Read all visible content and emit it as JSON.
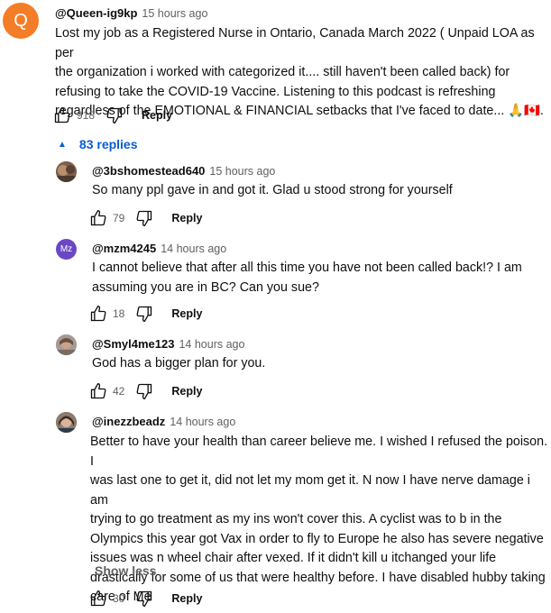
{
  "colors": {
    "link_blue": "#065fd4",
    "muted": "#606060",
    "avatar_main": "#f47d28",
    "avatar_mz": "#6b47c4"
  },
  "main_comment": {
    "avatar_letter": "Q",
    "author": "@Queen-ig9kp",
    "time": "15 hours ago",
    "lines": [
      "Lost my job as a Registered Nurse in Ontario, Canada  March 2022 ( Unpaid LOA as per",
      "the organization i worked with categorized it.... still haven't been called back) for",
      "refusing to take the COVID-19 Vaccine. Listening to this podcast is refreshing",
      "regardless of the EMOTIONAL & FINANCIAL setbacks that I've faced to date... 🙏🇨🇦."
    ],
    "likes": "918",
    "reply_label": "Reply"
  },
  "replies_toggle": {
    "label": "83 replies"
  },
  "replies": [
    {
      "author": "@3bshomestead640",
      "time": "15 hours ago",
      "avatar_letter": "",
      "lines": [
        "So many ppl gave in and got it. Glad u stood strong for yourself"
      ],
      "likes": "79",
      "reply_label": "Reply"
    },
    {
      "author": "@mzm4245",
      "time": "14 hours ago",
      "avatar_letter": "Mz",
      "lines": [
        "I cannot believe that after all this time you have not been called back!? I am",
        "assuming you are in BC? Can you sue?"
      ],
      "likes": "18",
      "reply_label": "Reply"
    },
    {
      "author": "@Smyl4me123",
      "time": "14 hours ago",
      "avatar_letter": "",
      "lines": [
        "God has a bigger plan for you."
      ],
      "likes": "42",
      "reply_label": "Reply"
    },
    {
      "author": "@inezzbeadz",
      "time": "14 hours ago",
      "avatar_letter": "",
      "lines": [
        "Better to have your health than career believe me. I wished I refused the poison. I",
        "was last one to get it, did not let my mom get it. N now I have nerve damage i am",
        "trying to go treatment as my ins won't cover this. A cyclist was to b in the",
        "Olympics this year got Vax in order to fly to Europe he also has severe negative",
        "issues was n wheel chair after vexed. If it didn't kill u itchanged your life",
        "drastically for some of us that were healthy before. I have disabled hubby taking",
        "care of Me"
      ],
      "show_less": "Show less",
      "likes": "30",
      "reply_label": "Reply"
    }
  ]
}
